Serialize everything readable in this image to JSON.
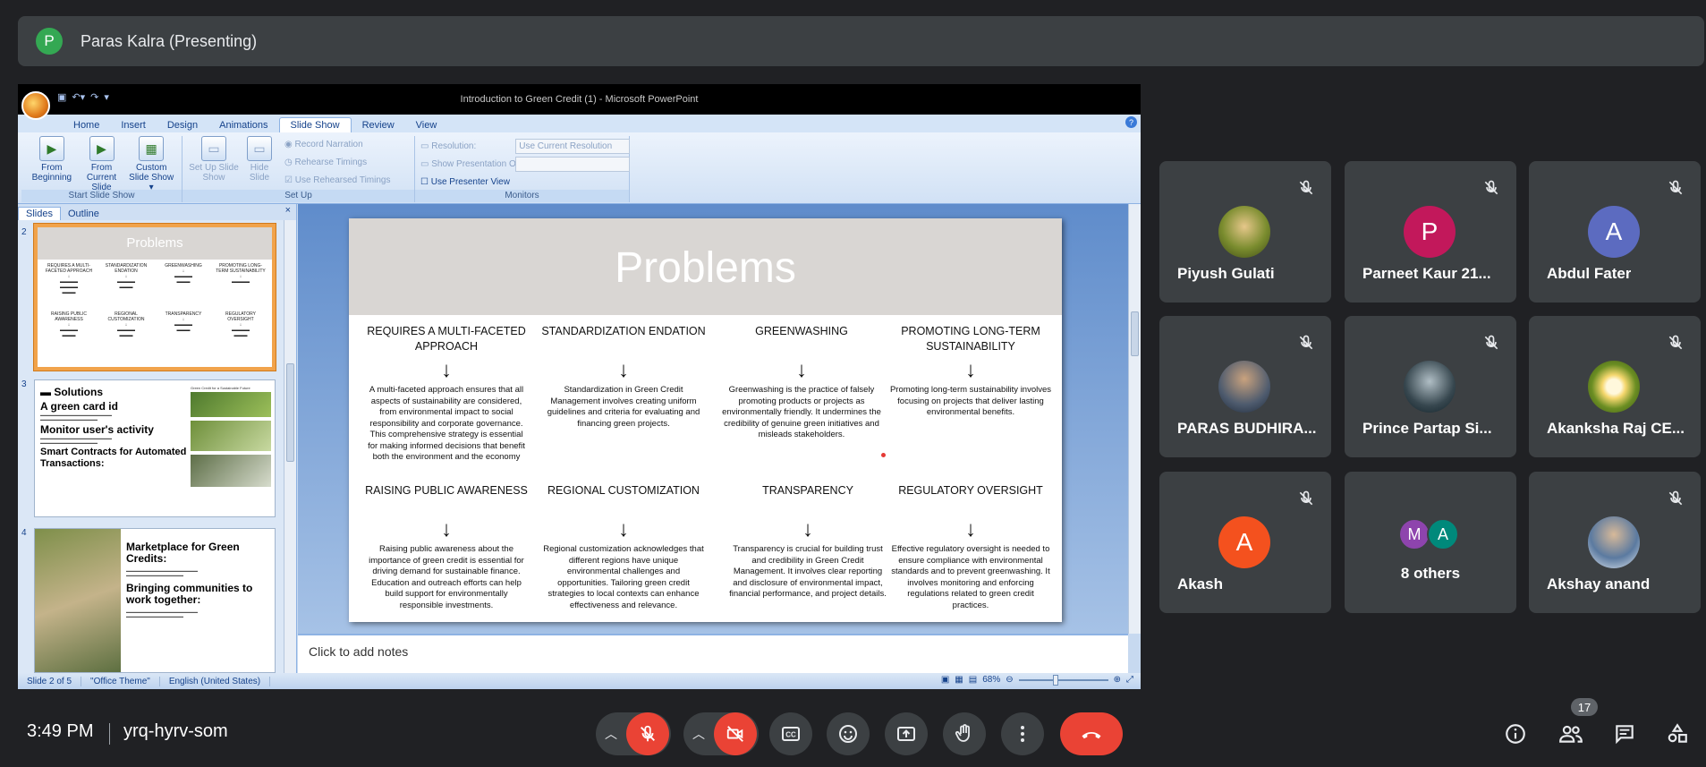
{
  "presenter": {
    "initial": "P",
    "label": "Paras Kalra (Presenting)",
    "avatar_color": "#34a853"
  },
  "powerpoint": {
    "window_title": "Introduction to Green Credit (1)  -  Microsoft PowerPoint",
    "ribbon_tabs": [
      "Home",
      "Insert",
      "Design",
      "Animations",
      "Slide Show",
      "Review",
      "View"
    ],
    "active_tab": "Slide Show",
    "groups": {
      "start": {
        "label": "Start Slide Show",
        "from_beginning": "From Beginning",
        "from_current": "From Current Slide",
        "custom": "Custom Slide Show ▾"
      },
      "setup": {
        "label": "Set Up",
        "setup_show": "Set Up Slide Show",
        "hide_slide": "Hide Slide",
        "record": "Record Narration",
        "rehearse": "Rehearse Timings",
        "use_rehearsed": "Use Rehearsed Timings"
      },
      "monitors": {
        "label": "Monitors",
        "resolution_label": "Resolution:",
        "resolution_value": "Use Current Resolution",
        "show_on_label": "Show Presentation On:",
        "presenter_view": "Use Presenter View"
      }
    },
    "pane_tabs": [
      "Slides",
      "Outline"
    ],
    "thumbnails": {
      "slide2": {
        "num": "2",
        "title": "Problems",
        "heads": [
          "REQUIRES A MULTI-FACETED APPROACH",
          "STANDARDIZATION ENDATION",
          "GREENWASHING",
          "PROMOTING LONG-TERM SUSTAINABILITY",
          "RAISING PUBLIC AWARENESS",
          "REGIONAL CUSTOMIZATION",
          "TRANSPARENCY",
          "REGULATORY OVERSIGHT"
        ]
      },
      "slide3": {
        "num": "3",
        "heading": "Solutions",
        "lines": [
          "A green card id",
          "Monitor user's activity",
          "Smart Contracts  for Automated Transactions:"
        ],
        "side_title": "Green Credit for a Sustainable Future"
      },
      "slide4": {
        "num": "4",
        "lines": [
          "Marketplace  for Green Credits:",
          "Bringing communities to work together:"
        ]
      }
    },
    "slide": {
      "title": "Problems",
      "cells": [
        {
          "head": "REQUIRES A MULTI-FACETED APPROACH",
          "body": "A multi-faceted approach ensures that all aspects of sustainability are considered, from environmental impact to social responsibility and corporate governance. This comprehensive strategy is essential for making informed decisions that benefit both the environment and the economy"
        },
        {
          "head": "STANDARDIZATION ENDATION",
          "body": "Standardization in Green Credit Management involves creating uniform guidelines and criteria for evaluating and financing green projects."
        },
        {
          "head": "GREENWASHING",
          "body": "Greenwashing is the practice of falsely promoting products or projects as environmentally friendly. It undermines the credibility of genuine green initiatives and misleads stakeholders."
        },
        {
          "head": "PROMOTING  LONG-TERM SUSTAINABILITY",
          "body": "Promoting long-term sustainability involves focusing on projects that deliver lasting environmental benefits."
        },
        {
          "head": "RAISING PUBLIC AWARENESS",
          "body": "Raising public awareness about the importance of green credit is essential for driving demand for sustainable finance. Education and outreach efforts can help build support for environmentally responsible investments."
        },
        {
          "head": "REGIONAL CUSTOMIZATION",
          "body": "Regional customization acknowledges that different regions have unique environmental challenges and opportunities. Tailoring green credit strategies to local contexts can enhance effectiveness and relevance."
        },
        {
          "head": "TRANSPARENCY",
          "body": "Transparency is crucial for building trust and credibility in Green Credit Management. It involves clear reporting and disclosure of environmental impact, financial performance, and project details."
        },
        {
          "head": "REGULATORY OVERSIGHT",
          "body": "Effective regulatory oversight is needed to ensure compliance with environmental standards and to prevent greenwashing. It involves monitoring and enforcing regulations related to green credit practices."
        }
      ]
    },
    "notes_placeholder": "Click to add notes",
    "status": {
      "slide": "Slide 2 of 5",
      "theme": "\"Office Theme\"",
      "language": "English (United States)",
      "zoom": "68%"
    }
  },
  "participants": [
    {
      "name": "Piyush Gulati",
      "initial": "",
      "color": "#7a8c2e",
      "photo": true,
      "muted": true
    },
    {
      "name": "Parneet Kaur 21...",
      "initial": "P",
      "color": "#c2185b",
      "photo": false,
      "muted": true
    },
    {
      "name": "Abdul Fater",
      "initial": "A",
      "color": "#5c6bc0",
      "photo": false,
      "muted": true
    },
    {
      "name": "PARAS BUDHIRA...",
      "initial": "",
      "color": "#4e5b6e",
      "photo": true,
      "muted": true
    },
    {
      "name": "Prince Partap Si...",
      "initial": "",
      "color": "#37474f",
      "photo": true,
      "muted": true
    },
    {
      "name": "Akanksha Raj CE...",
      "initial": "",
      "color": "#6b8e23",
      "photo": true,
      "muted": true
    },
    {
      "name": "Akash",
      "initial": "A",
      "color": "#f4511e",
      "photo": false,
      "muted": true
    },
    {
      "name": "Akshay anand",
      "initial": "",
      "color": "#8d9aa8",
      "photo": true,
      "muted": true
    }
  ],
  "others": {
    "label": "8 others",
    "initials": [
      "M",
      "A"
    ],
    "colors": [
      "#8e44ad",
      "#00897b"
    ]
  },
  "meeting": {
    "time": "3:49 PM",
    "code": "yrq-hyrv-som",
    "people_count": "17"
  },
  "colors": {
    "end_call": "#ea4335",
    "tile_bg": "#3c4043",
    "page_bg": "#202124"
  }
}
